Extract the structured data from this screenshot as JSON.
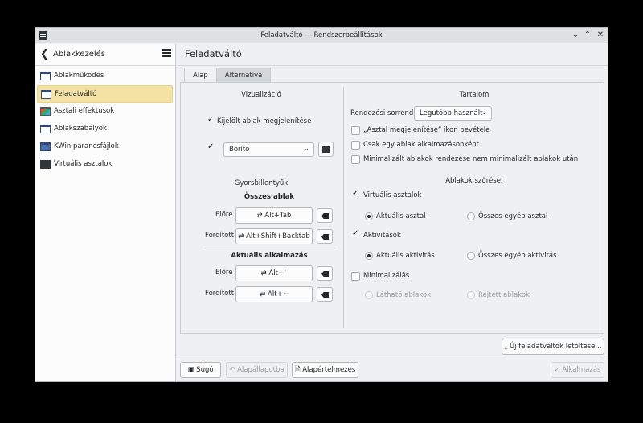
{
  "window": {
    "title": "Feladatváltó — Rendszerbeállítások",
    "controls": [
      "⌄",
      "⌃",
      "✕"
    ]
  },
  "sidebar": {
    "back_glyph": "❮",
    "title": "Ablakkezelés",
    "items": [
      {
        "label": "Ablakműködés"
      },
      {
        "label": "Feladatváltó"
      },
      {
        "label": "Asztali effektusok"
      },
      {
        "label": "Ablakszabályok"
      },
      {
        "label": "KWin parancsfájlok"
      },
      {
        "label": "Virtuális asztalok"
      }
    ]
  },
  "main": {
    "title": "Feladatváltó",
    "tabs": [
      {
        "label": "Alap"
      },
      {
        "label": "Alternatíva"
      }
    ]
  },
  "visualization": {
    "title": "Vizualizáció",
    "show_selected_label": "Kijelölt ablak megjelenítése",
    "style_value": "Borító"
  },
  "shortcuts": {
    "title": "Gyorsbillentyűk",
    "all_windows_title": "Összes ablak",
    "current_app_title": "Aktuális alkalmazás",
    "forward_label": "Előre",
    "reverse_label": "Fordított",
    "all_forward": "Alt+Tab",
    "all_reverse": "Alt+Shift+Backtab",
    "app_forward": "Alt+`",
    "app_reverse": "Alt+~",
    "swap_glyph": "⇄",
    "clear_glyph": "⌫"
  },
  "content": {
    "title": "Tartalom",
    "sort_label": "Rendezési sorrend:",
    "sort_value": "Legutóbb használt",
    "opt_show_desktop": "„Asztal megjelenítése” ikon bevétele",
    "opt_one_per_app": "Csak egy ablak alkalmazásonként",
    "opt_minimized_last": "Minimalizált ablakok rendezése nem minimalizált ablakok után"
  },
  "filter": {
    "title": "Ablakok szűrése:",
    "virtual_desktops": "Virtuális asztalok",
    "current_desktop": "Aktuális asztal",
    "all_other_desktops": "Összes egyéb asztal",
    "activities": "Aktivitások",
    "current_activity": "Aktuális aktivitás",
    "all_other_activities": "Összes egyéb aktivitás",
    "minimization": "Minimalizálás",
    "visible_windows": "Látható ablakok",
    "hidden_windows": "Rejtett ablakok"
  },
  "get_new_button": "Új feladatváltók letöltése...",
  "footer": {
    "help": "Súgó",
    "defaults_reset": "Alapállapotba",
    "defaults": "Alapértelmezés",
    "apply": "Alkalmazás"
  }
}
